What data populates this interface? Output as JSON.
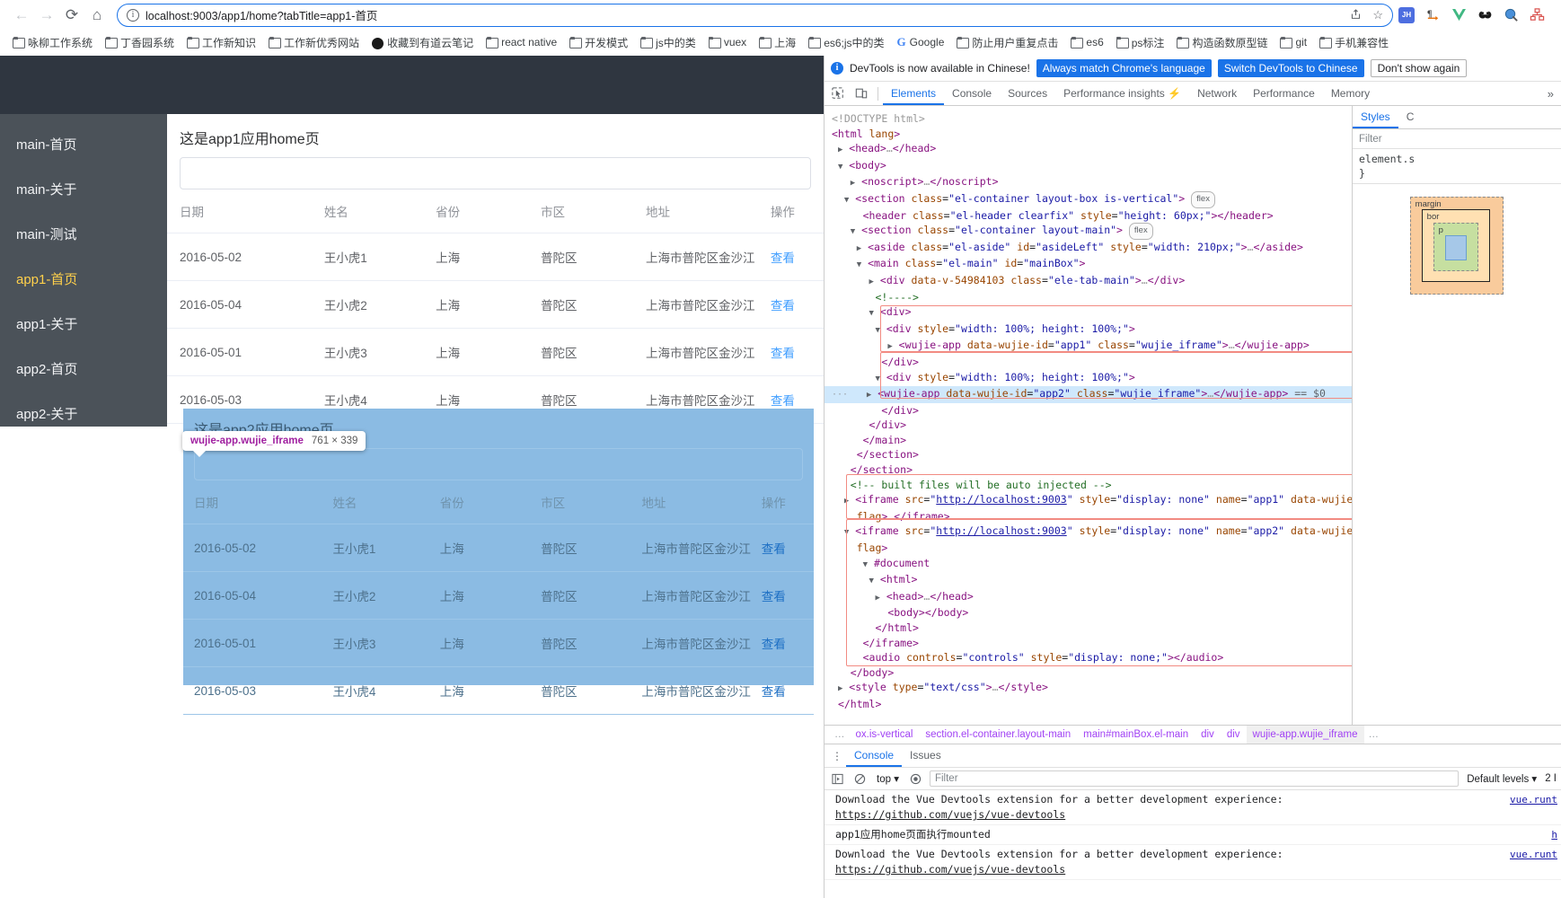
{
  "browser": {
    "url": "localhost:9003/app1/home?tabTitle=app1-首页",
    "nav": {
      "back": "←",
      "forward": "→",
      "reload": "⟳",
      "home": "⌂"
    },
    "omni_share": "share-icon",
    "omni_star": "☆",
    "extensions": [
      "JH",
      "¶",
      "V",
      "••",
      "Q",
      "品"
    ],
    "bookmarks": [
      {
        "label": "咏柳工作系统",
        "icon": "folder"
      },
      {
        "label": "丁香园系统",
        "icon": "folder"
      },
      {
        "label": "工作新知识",
        "icon": "folder"
      },
      {
        "label": "工作新优秀网站",
        "icon": "folder"
      },
      {
        "label": "收藏到有道云笔记",
        "icon": "circle"
      },
      {
        "label": "react native",
        "icon": "folder"
      },
      {
        "label": "开发模式",
        "icon": "folder"
      },
      {
        "label": "js中的类",
        "icon": "folder"
      },
      {
        "label": "vuex",
        "icon": "folder"
      },
      {
        "label": "上海",
        "icon": "folder"
      },
      {
        "label": "es6;js中的类",
        "icon": "folder"
      },
      {
        "label": "Google",
        "icon": "google"
      },
      {
        "label": "防止用户重复点击",
        "icon": "folder"
      },
      {
        "label": "es6",
        "icon": "folder"
      },
      {
        "label": "ps标注",
        "icon": "folder"
      },
      {
        "label": "构造函数原型链",
        "icon": "folder"
      },
      {
        "label": "git",
        "icon": "folder"
      },
      {
        "label": "手机兼容性",
        "icon": "folder"
      }
    ]
  },
  "page": {
    "sidebar": [
      {
        "label": "main-首页",
        "active": false
      },
      {
        "label": "main-关于",
        "active": false
      },
      {
        "label": "main-测试",
        "active": false
      },
      {
        "label": "app1-首页",
        "active": true
      },
      {
        "label": "app1-关于",
        "active": false
      },
      {
        "label": "app2-首页",
        "active": false
      },
      {
        "label": "app2-关于",
        "active": false
      }
    ],
    "app1": {
      "title": "这是app1应用home页",
      "columns": [
        "日期",
        "姓名",
        "省份",
        "市区",
        "地址",
        "操作"
      ],
      "rows": [
        {
          "date": "2016-05-02",
          "name": "王小虎1",
          "province": "上海",
          "city": "普陀区",
          "address": "上海市普陀区金沙江",
          "action": "查看"
        },
        {
          "date": "2016-05-04",
          "name": "王小虎2",
          "province": "上海",
          "city": "普陀区",
          "address": "上海市普陀区金沙江",
          "action": "查看"
        },
        {
          "date": "2016-05-01",
          "name": "王小虎3",
          "province": "上海",
          "city": "普陀区",
          "address": "上海市普陀区金沙江",
          "action": "查看"
        },
        {
          "date": "2016-05-03",
          "name": "王小虎4",
          "province": "上海",
          "city": "普陀区",
          "address": "上海市普陀区金沙江",
          "action": "查看"
        }
      ]
    },
    "app2": {
      "title": "这是app2应用home页",
      "columns": [
        "日期",
        "姓名",
        "省份",
        "市区",
        "地址",
        "操作"
      ],
      "rows": [
        {
          "date": "2016-05-02",
          "name": "王小虎1",
          "province": "上海",
          "city": "普陀区",
          "address": "上海市普陀区金沙江",
          "action": "查看"
        },
        {
          "date": "2016-05-04",
          "name": "王小虎2",
          "province": "上海",
          "city": "普陀区",
          "address": "上海市普陀区金沙江",
          "action": "查看"
        },
        {
          "date": "2016-05-01",
          "name": "王小虎3",
          "province": "上海",
          "city": "普陀区",
          "address": "上海市普陀区金沙江",
          "action": "查看"
        },
        {
          "date": "2016-05-03",
          "name": "王小虎4",
          "province": "上海",
          "city": "普陀区",
          "address": "上海市普陀区金沙江",
          "action": "查看"
        }
      ]
    },
    "inspector_tooltip": {
      "selector": "wujie-app.wujie_iframe",
      "dimensions": "761 × 339"
    }
  },
  "devtools": {
    "banner": {
      "message": "DevTools is now available in Chinese!",
      "btn_always": "Always match Chrome's language",
      "btn_switch": "Switch DevTools to Chinese",
      "btn_dismiss": "Don't show again"
    },
    "tabs": [
      {
        "label": "Elements",
        "active": true
      },
      {
        "label": "Console",
        "active": false
      },
      {
        "label": "Sources",
        "active": false
      },
      {
        "label": "Performance insights ⚡",
        "active": false
      },
      {
        "label": "Network",
        "active": false
      },
      {
        "label": "Performance",
        "active": false
      },
      {
        "label": "Memory",
        "active": false
      }
    ],
    "more": "»",
    "styles": {
      "tabs": [
        {
          "label": "Styles",
          "active": true
        },
        {
          "label": "C",
          "active": false
        }
      ],
      "filter_placeholder": "Filter",
      "rule": "element.s",
      "rule_close": "}",
      "boxmodel": {
        "margin": "margin",
        "border": "bor",
        "padding": "p",
        "dash": "-"
      }
    },
    "breadcrumbs": [
      {
        "label": "…",
        "gray": true
      },
      {
        "label": "ox.is-vertical",
        "gray": false
      },
      {
        "label": "section.el-container.layout-main",
        "gray": false
      },
      {
        "label": "main#mainBox.el-main",
        "gray": false
      },
      {
        "label": "div",
        "gray": false
      },
      {
        "label": "div",
        "gray": false
      },
      {
        "label": "wujie-app.wujie_iframe",
        "gray": false,
        "selected": true
      },
      {
        "label": "…",
        "gray": true
      }
    ],
    "console": {
      "tabs": [
        {
          "label": "Console",
          "active": true
        },
        {
          "label": "Issues",
          "active": false
        }
      ],
      "top_label": "top",
      "filter_placeholder": "Filter",
      "levels_label": "Default levels",
      "issues_count": "2 I",
      "logs": [
        {
          "msg": "Download the Vue Devtools extension for a better development experience:",
          "link": "https://github.com/vuejs/vue-devtools",
          "src": "vue.runt"
        },
        {
          "msg": "app1应用home页面执行mounted",
          "link": "",
          "src": "h"
        },
        {
          "msg": "Download the Vue Devtools extension for a better development experience:",
          "link": "https://github.com/vuejs/vue-devtools",
          "src": "vue.runt"
        }
      ]
    }
  }
}
